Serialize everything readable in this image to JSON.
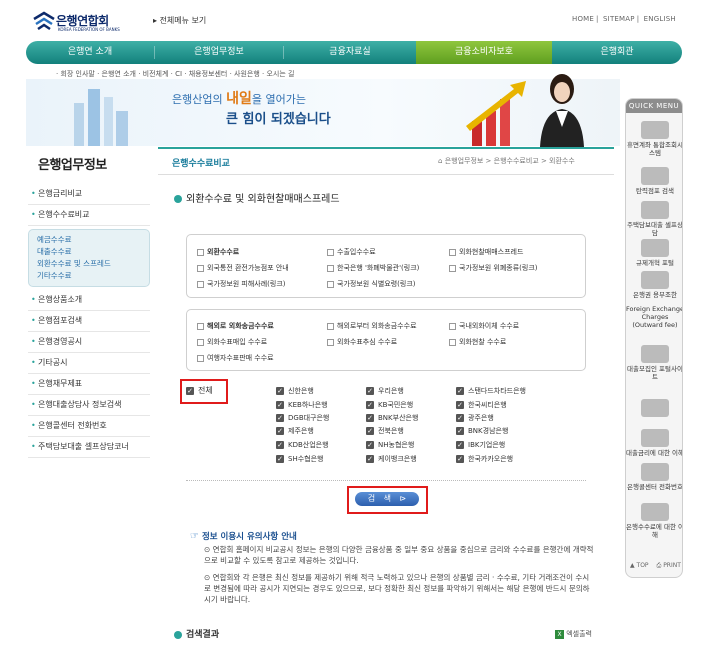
{
  "header": {
    "logo_text": "은행연합회",
    "logo_sub": "KOREA FEDERATION OF BANKS",
    "sitemap_link": "전체메뉴 보기",
    "util": [
      "HOME",
      "SITEMAP",
      "ENGLISH"
    ]
  },
  "gnb": [
    {
      "label": "은행연 소개"
    },
    {
      "label": "은행업무정보"
    },
    {
      "label": "금융자료실"
    },
    {
      "label": "금융소비자보호"
    },
    {
      "label": "은행회관"
    }
  ],
  "subnav": "· 회장 인사말 · 은행연 소개 · 비전체계 · CI · 채용정보센터 · 사원은행 · 오시는 길",
  "hero": {
    "line1_a": "은행산업의 ",
    "line1_b": "내일",
    "line1_c": "을 열어가는",
    "line2": "큰 힘이 되겠습니다"
  },
  "left": {
    "title": "은행업무정보",
    "items_top": [
      "은행금리비교",
      "은행수수료비교"
    ],
    "sub_items": [
      "예금수수료",
      "대출수수료",
      "외환수수료 및 스프레드",
      "기타수수료"
    ],
    "items_bottom": [
      "은행상품소개",
      "은행점포검색",
      "은행경영공시",
      "기타공시",
      "은행재무제표",
      "은행대출상담사 정보검색",
      "은행콜센터 전화번호",
      "주택담보대출 셀프상담코너"
    ]
  },
  "content": {
    "title": "은행수수료비교",
    "breadcrumb": "은행업무정보 > 은행수수료비교 > 외환수수",
    "section_title": "외환수수료 및 외화현찰매매스프레드"
  },
  "box1": {
    "items": [
      "외환수수료",
      "수출입수수료",
      "외화현찰매매스프레드",
      "외국통전 환전가능점포 안내",
      "한국은행 '화폐박물관'(링크)",
      "국가정보원 위폐종류(링크)",
      "국가정보원 피해사례(링크)",
      "국가정보원 식별요령(링크)"
    ]
  },
  "box2": {
    "items": [
      "해외로 외화송금수수료",
      "해외로부터 외화송금수수료",
      "국내외화이체 수수료",
      "외화수표매입 수수료",
      "외화수표추심 수수료",
      "외화현찰 수수료",
      "여행자수표판매 수수료"
    ]
  },
  "banks": {
    "all_label": "전체",
    "list": [
      "신한은행",
      "우리은행",
      "스탠다드차타드은행",
      "KEB하나은행",
      "KB국민은행",
      "한국씨티은행",
      "DGB대구은행",
      "BNK부산은행",
      "광주은행",
      "제주은행",
      "전북은행",
      "BNK경남은행",
      "KDB산업은행",
      "NH농협은행",
      "IBK기업은행",
      "SH수협은행",
      "케이뱅크은행",
      "한국카카오은행"
    ]
  },
  "search_button": "검 색",
  "info": {
    "title": "정보 이용시 유의사항 안내",
    "p1": "⊙ 연합회 홈페이지 비교공시 정보는 은행의 다양한 금융상품 중 일부 중요 상품을 중심으로 금리와 수수료를 은행간에 개략적으로 비교할 수 있도록 참고로 제공하는 것입니다.",
    "p2": "⊙ 연합회와 각 은행은 최신 정보를 제공하기 위해 적극 노력하고 있으나 은행의 상품별 금리 · 수수료, 기타 거래조건이 수시로 변경됨에 따라 공시가 지연되는 경우도 있으므로, 보다 정확한 최신 정보를 파악하기 위해서는 해당 은행에 반드시 문의하시기 바랍니다."
  },
  "result_title": "검색결과",
  "excel_label": "엑셀출력",
  "quick": {
    "head": "QUICK MENU",
    "items": [
      "휴면계좌 통합조회시스템",
      "탄력점포 검색",
      "주택담보대출 셀프상담",
      "규제개혁 포털",
      "은행권 용부조한",
      "Foreign Exchange Charges (Outward fee)",
      "대출모집인 포털사이트",
      "",
      "대출금리에 대한 이해",
      "은행콜센터 전화번호",
      "은행수수료에 대한 이해"
    ],
    "bottom": [
      "TOP",
      "PRINT"
    ]
  }
}
